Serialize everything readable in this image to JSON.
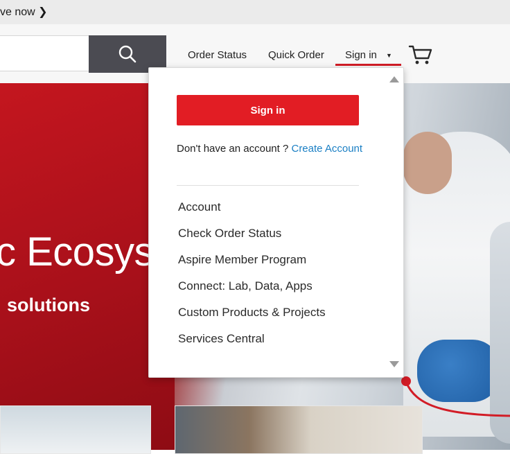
{
  "promo": {
    "text": "ve now ❯"
  },
  "search": {
    "placeholder": ""
  },
  "nav": {
    "order_status": "Order Status",
    "quick_order": "Quick Order",
    "sign_in": "Sign in",
    "caret": "▼"
  },
  "hero": {
    "title": "c Ecosyst",
    "subtitle": "solutions"
  },
  "dropdown": {
    "sign_in_button": "Sign in",
    "account_prompt": "Don't have an account ? ",
    "create_account_link": "Create Account",
    "menu_items": [
      "Account",
      "Check Order Status",
      "Aspire Member Program",
      "Connect: Lab, Data, Apps",
      "Custom Products & Projects",
      "Services Central"
    ]
  },
  "colors": {
    "brand_red": "#e21d24",
    "link_blue": "#1a7fc4",
    "search_button": "#4b4b52"
  },
  "icons": [
    "search-icon",
    "cart-icon",
    "caret-down-icon",
    "scroll-up-icon",
    "scroll-down-icon"
  ]
}
